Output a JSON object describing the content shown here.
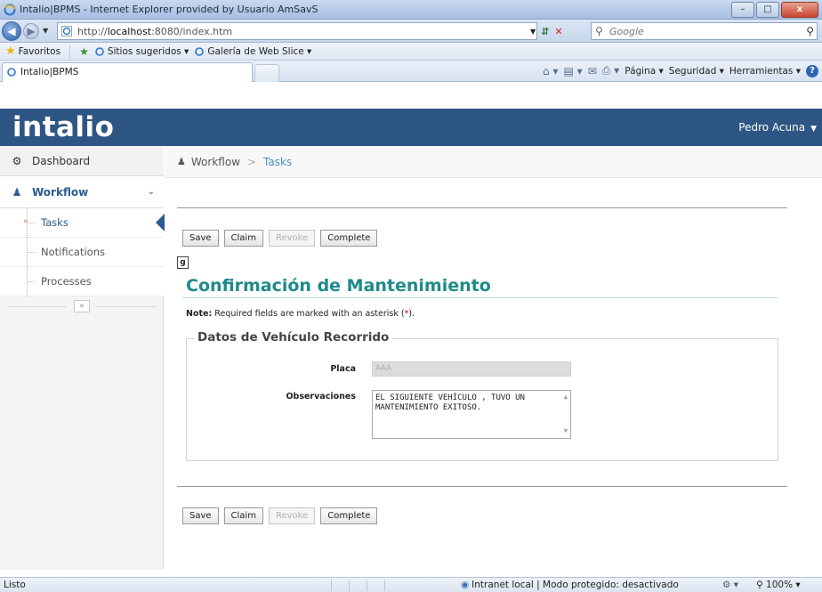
{
  "browser": {
    "window_title": "Intalio|BPMS - Internet Explorer provided by Usuario AmSavS",
    "url_prefix": "http://",
    "url_host": "localhost",
    "url_rest": ":8080/index.htm",
    "search_placeholder": "Google",
    "favorites_label": "Favoritos",
    "suggested_sites": "Sitios sugeridos ▾",
    "web_slice_gallery": "Galería de Web Slice ▾",
    "tab_label": "Intalio|BPMS",
    "cmd_page": "Página ▾",
    "cmd_security": "Seguridad ▾",
    "cmd_tools": "Herramientas ▾"
  },
  "app": {
    "logo": "intalio",
    "user_name": "Pedro Acuna"
  },
  "sidebar": {
    "dashboard": "Dashboard",
    "workflow": "Workflow",
    "items": [
      {
        "label": "Tasks",
        "active": true
      },
      {
        "label": "Notifications",
        "active": false
      },
      {
        "label": "Processes",
        "active": false
      }
    ],
    "collapse_glyph": "«"
  },
  "breadcrumb": {
    "section": "Workflow",
    "separator": ">",
    "current": "Tasks"
  },
  "form": {
    "buttons": {
      "save": "Save",
      "claim": "Claim",
      "revoke": "Revoke",
      "complete": "Complete"
    },
    "type_badge": "g",
    "title": "Confirmación de Mantenimiento",
    "note_label": "Note:",
    "note_text_before": " Required fields are marked with an asterisk (",
    "note_asterisk": "*",
    "note_text_after": ").",
    "fieldset_legend": "Datos de Vehículo Recorrido",
    "fields": {
      "placa_label": "Placa",
      "placa_value": "AAA",
      "observaciones_label": "Observaciones",
      "observaciones_value": "EL SIGUIENTE VEHÍCULO , TUVO UN MANTENIMIENTO EXITOSO."
    }
  },
  "statusbar": {
    "text": "Listo",
    "zone": "Intranet local | Modo protegido: desactivado",
    "zoom": "100%"
  }
}
